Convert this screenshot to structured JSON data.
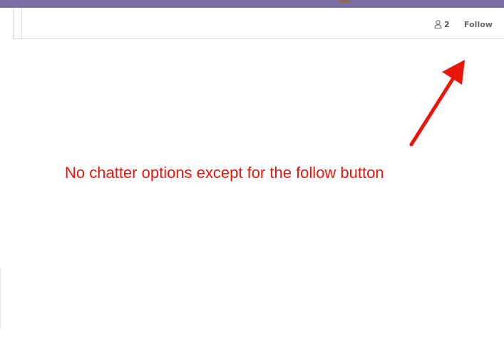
{
  "chatter": {
    "followers_count": "2",
    "followers_icon": "user-icon",
    "follow_label": "Follow"
  },
  "annotation": {
    "text": "No chatter options except for the follow button",
    "color": "#e8160c",
    "arrow_icon": "arrow-pointer"
  },
  "colors": {
    "top_bar": "#7c6fa8",
    "border": "#d9d9d9"
  }
}
